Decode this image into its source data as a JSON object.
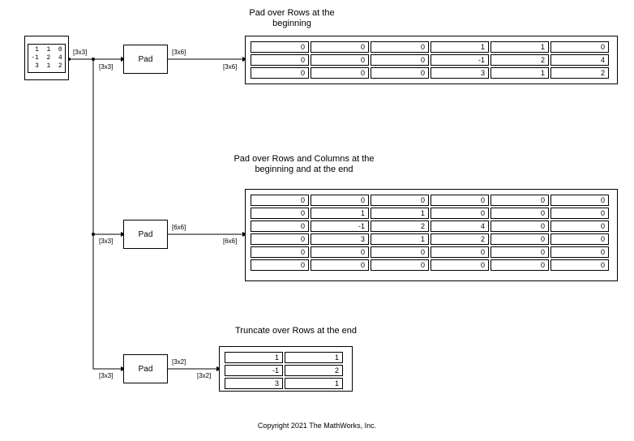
{
  "constant_matrix": " 1  1  0\n-1  2  4\n 3  1  2",
  "pad_block_label": "Pad",
  "labels": {
    "title1_line1": "Pad over Rows at the",
    "title1_line2": "beginning",
    "title2_line1": "Pad over Rows and Columns at the",
    "title2_line2": "beginning and at the end",
    "title3": "Truncate over Rows at the end"
  },
  "signals": {
    "s3x3": "[3x3]",
    "s3x6": "[3x6]",
    "s6x6": "[6x6]",
    "s3x2": "[3x2]"
  },
  "chart_data": {
    "type": "table",
    "input_matrix": [
      [
        1,
        1,
        0
      ],
      [
        -1,
        2,
        4
      ],
      [
        3,
        1,
        2
      ]
    ],
    "displays": [
      {
        "name": "Pad over Rows at the beginning",
        "size": "3x6",
        "values": [
          [
            0,
            0,
            0,
            1,
            1,
            0
          ],
          [
            0,
            0,
            0,
            -1,
            2,
            4
          ],
          [
            0,
            0,
            0,
            3,
            1,
            2
          ]
        ]
      },
      {
        "name": "Pad over Rows and Columns at the beginning and at the end",
        "size": "6x6",
        "values": [
          [
            0,
            0,
            0,
            0,
            0,
            0
          ],
          [
            0,
            1,
            1,
            0,
            0,
            0
          ],
          [
            0,
            -1,
            2,
            4,
            0,
            0
          ],
          [
            0,
            3,
            1,
            2,
            0,
            0
          ],
          [
            0,
            0,
            0,
            0,
            0,
            0
          ],
          [
            0,
            0,
            0,
            0,
            0,
            0
          ]
        ]
      },
      {
        "name": "Truncate over Rows at the end",
        "size": "3x2",
        "values": [
          [
            1,
            1
          ],
          [
            -1,
            2
          ],
          [
            3,
            1
          ]
        ]
      }
    ]
  },
  "footer": "Copyright 2021 The MathWorks, Inc."
}
